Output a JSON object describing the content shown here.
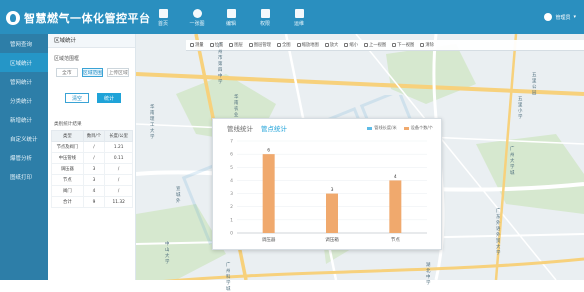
{
  "app": {
    "title": "智慧燃气一体化管控平台"
  },
  "nav": [
    {
      "label": "首页",
      "icon": "home-icon"
    },
    {
      "label": "一张图",
      "icon": "map-layers-icon"
    },
    {
      "label": "编辑",
      "icon": "edit-icon"
    },
    {
      "label": "权限",
      "icon": "user-permission-icon"
    },
    {
      "label": "运维",
      "icon": "monitor-icon"
    }
  ],
  "user": {
    "name": "管理员"
  },
  "sidebar": {
    "items": [
      {
        "label": "管网查询",
        "active": false
      },
      {
        "label": "区域统计",
        "active": true
      },
      {
        "label": "管网统计",
        "active": false
      },
      {
        "label": "分类统计",
        "active": false
      },
      {
        "label": "新增统计",
        "active": false
      },
      {
        "label": "自定义统计",
        "active": false
      },
      {
        "label": "爆管分析",
        "active": false
      },
      {
        "label": "图纸打印",
        "active": false
      }
    ]
  },
  "panel": {
    "title": "区域统计",
    "range_label": "区域范围框",
    "range_buttons": [
      "全市",
      "区域范围",
      "上传区域"
    ],
    "active_range": 1,
    "clear_label": "清空",
    "stat_label": "统计",
    "result_title": "类别统计结果",
    "columns": [
      "类型",
      "数目/个",
      "长度/公里"
    ],
    "rows": [
      [
        "节点及阀门",
        "/",
        "1.21"
      ],
      [
        "中压管线",
        "/",
        "0.11"
      ],
      [
        "调压器",
        "3",
        "/"
      ],
      [
        "节点",
        "3",
        "/"
      ],
      [
        "阀门",
        "4",
        "/"
      ]
    ],
    "total": [
      "合计",
      "9",
      "11.32"
    ]
  },
  "toolbar": {
    "items": [
      "测量",
      "位置",
      "图层",
      "图层管理",
      "全图",
      "缩放地图",
      "放大",
      "缩小",
      "上一视图",
      "下一视图",
      "清除"
    ]
  },
  "dialog": {
    "tabs": [
      "管线统计",
      "管点统计"
    ],
    "active_tab": 1,
    "legend": [
      "管线长度/米",
      "设备个数/个"
    ]
  },
  "colors": {
    "topbar": "#2a8fbf",
    "sidebar": "#2d7ea8",
    "accent": "#1fa3d8",
    "bar": "#f0a96d"
  },
  "chart_data": {
    "type": "bar",
    "categories": [
      "调压器",
      "调压箱",
      "节点"
    ],
    "series": [
      {
        "name": "管线长度/米",
        "values": [
          0,
          0,
          0
        ]
      },
      {
        "name": "设备个数/个",
        "values": [
          6,
          3,
          4
        ]
      }
    ],
    "data_labels": [
      "6",
      "3",
      "4"
    ],
    "ylim": [
      0,
      7
    ],
    "yticks": [
      0,
      1,
      2,
      3,
      4,
      5,
      6,
      7
    ]
  },
  "map_labels": [
    "五里公园",
    "广州市第四中学",
    "华南农业大学",
    "五里小学",
    "华南理工大学",
    "广州大学城",
    "宣城外",
    "广东外语外贸大学",
    "广州科学城",
    "湖北中学",
    "中山大学"
  ]
}
